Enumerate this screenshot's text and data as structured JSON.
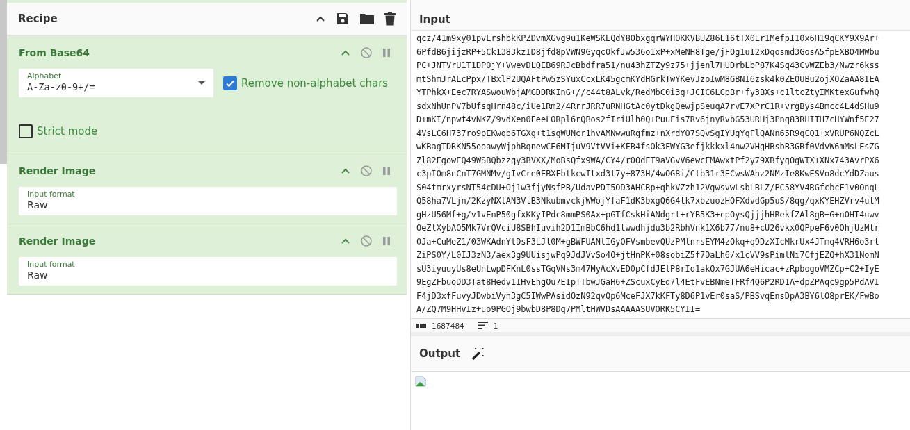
{
  "recipe": {
    "title": "Recipe",
    "operations": [
      {
        "name": "From Base64",
        "args": [
          {
            "kind": "select",
            "label": "Alphabet",
            "value": "A-Za-z0-9+/="
          },
          {
            "kind": "checkbox",
            "label": "Remove non-alphabet chars",
            "checked": true
          },
          {
            "kind": "checkbox",
            "label": "Strict mode",
            "checked": false
          }
        ]
      },
      {
        "name": "Render Image",
        "args": [
          {
            "kind": "text",
            "label": "Input format",
            "value": "Raw"
          }
        ]
      },
      {
        "name": "Render Image",
        "args": [
          {
            "kind": "text",
            "label": "Input format",
            "value": "Raw"
          }
        ]
      }
    ]
  },
  "input": {
    "title": "Input",
    "lines": [
      "qcz/41m9xy01pvLrshbkKPZDvmXGvg9u1KeWSKLQdY8ObxgqrWYHOKKVBUZ86E16tTX0Lr1MefpI10x6H19qCKY9X9Ar+",
      "6PfdB6jijzRP+5Ck1383kzID8jfd8pVWN9GyqcOkfJw536o1xP+xMeNH8Tge/jFOg1uI2xDqosmd3GosA5fpEXBO4MWbu",
      "PC+JNTVrU1T1DPOjY+VwevDLQEB69RJcBbdfra51/nu43hZTZy9z75+jjenl7HUDrbLbP87K4Sq43CvWZEb3/Nwzr6kss",
      "mtShmJrALcPpx/TBxlP2UQAFtPw5zSYuxCcxLK45gcmKYdHGrkTwYKevJzoIwM8GBNI6zsk4k0ZEOUBu2ojXOZaAA8IEA",
      "YTPhkX+Eec7RYASwouWbjAMGDDRKInG+//c44t8ALvk/RedMbC0i3g+JCIC6LGpBr+fy3BXs+c1ltcZtyIMKtexGufwhQ",
      "sdxNhUnPV7bUfsqHrn48c/iUe1Rm2/4RrrJRR7uRNHGtAc0ytDkgQewjpSeuqA7rvE7XPrC1R+vrgBys4Bmcc4L4dSHu9",
      "D+mKI/npwt4vNKZ/9vdXen0EeeLORpl6rQBos2fIriUlh0Q+PuuFis7Rv6jnyRvbG53URHj3Pnq83RHITH7cHYWnf5E27",
      "4VsLC6H737ro9pEKwqb6TGXg+t1sgWUNcr1hvAMNwwuRgfmz+nXrdYO7SQvSgIYUgYqFlQANn65R9qCQ1+xVRUP6NQZcL",
      "wKBagTDRKN55ooawyWjphBqnewCE6MIjuV9VtVVi+KFB4fsOk3FWYG3efjkkkxl4nw2VHgHBsbB3GRf0VdvW6mMsLEsZG",
      "Zl82EgowEQ49WSBQbzzqy3BVXX/MoBsQfx9WA/CY4/r0OdFT9aVGvV6ewcFMAwxtPf2y79XBfygOgWTX+XNx743AvrPX6",
      "c3pIOm8nCnT7GMNMv/gIvCre0EBXFbtkcwItxd3t7y+873H/4wOG8i/Ctb31r3ECwsWAhz2NMzIe8KwESVo8dcYdDZaus",
      "S04tmrxyrsNT54cDU+Oj1w3fjyNsfPB/UdavPDI5OD3AHCRp+qhkVZzh12VgwsvwLsbLBLZ/PC58YV4RGfcbcF1v0OnqL",
      "Q58ha7VLjn/2KzyNXtAN3VtB3NkubmvckjWWojYfaF1dK3bxgQ6G4tk7xbzuozHOFXdvdGp5uS/8qg/qxKYEHZVrv4utM",
      "gHzU56Mf+g/v1vEnP50gfxKKyIPdc8mmPS0Ax+pGTfCskHiANdgrt+rYB5K3+cpOysQjjjhHRekfZAl8gB+G+nOHT4uwv",
      "OeZlXybAO5Mk7VrQVciU8SBhIuvih2D1ImBbC6hd1twwdhjdu3b2RbhVnk1X6b77/nu8+cU26vkx0QPpeF6v0QhjUzMtr",
      "0Ja+CuMeZ1/03WKAdnYtDsF3LJl0M+gBWFUANlIGyOFVsmbevQUzPMlnrsEYM4zOkq+q9DzXIcMkrUx4JTmq4VRH6o3rt",
      "ZiPS0Y/L0IJ3zN3/aex3g9UUisjwPq9JdJVvSo4O+jtHnPK+08sobiZ5f7DaLh6/x1cVV9sPimlNi7CfjEZQ+hX31NomN",
      "sU3iyuuyUs8eUnLwpDFKnL0ssTGqVNs3m47MyAcXvED0pCfdJElP8rIo1akQx7GJUA6eHicac+zRpbogoVMZCp+C2+IyE",
      "9EgZFbuoDD3Tat8Hedv1IHvEhgOu7EIpTTbwJGaH6+ZScuxCyEd7l4EtFvEBNmeTFRf4Q6P2RD1A+dpZPAqc9gp5PdAVI",
      "F4jD3xfFuvyJDwbiVyn3gC5IWwPAsidOzN92qvQp6MceFJX7kKFTy8D6P1vEr0saS/PBSvqEnsDpA3BY6lO8prEK/FwBo",
      "A/ZQ7M9HHvIz+uo9PGOj9bwbD8P8Dq7PMltHWVDsAAAAASUVORK5CYII="
    ],
    "length": "1687484",
    "line_count": "1"
  },
  "output": {
    "title": "Output"
  }
}
